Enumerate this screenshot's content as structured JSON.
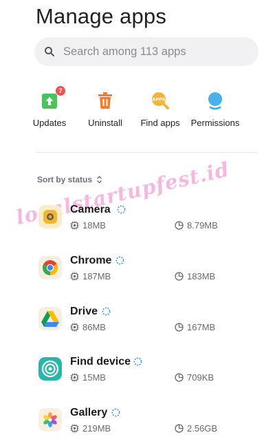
{
  "header": {
    "title": "Manage apps"
  },
  "search": {
    "placeholder": "Search among 113 apps",
    "icon": "search-icon"
  },
  "actions": [
    {
      "label": "Updates",
      "icon": "updates-icon",
      "badge": "7",
      "color": "#4cc25b"
    },
    {
      "label": "Uninstall",
      "icon": "trash-icon",
      "color": "#f57c2a"
    },
    {
      "label": "Find apps",
      "icon": "find-apps-icon",
      "icon_text": "APPS",
      "color": "#f2b53a"
    },
    {
      "label": "Permissions",
      "icon": "permissions-icon",
      "color": "#4ab0ec"
    }
  ],
  "sort": {
    "label": "Sort by status"
  },
  "watermark": "localstartupfest.id",
  "apps": [
    {
      "name": "Camera",
      "storage": "18MB",
      "data": "8.79MB",
      "icon": "camera-app-icon"
    },
    {
      "name": "Chrome",
      "storage": "187MB",
      "data": "183MB",
      "icon": "chrome-app-icon"
    },
    {
      "name": "Drive",
      "storage": "86MB",
      "data": "167MB",
      "icon": "drive-app-icon"
    },
    {
      "name": "Find device",
      "storage": "15MB",
      "data": "709KB",
      "icon": "find-device-app-icon"
    },
    {
      "name": "Gallery",
      "storage": "219MB",
      "data": "2.56GB",
      "icon": "gallery-app-icon"
    }
  ],
  "colors": {
    "accent": "#3b8ee0",
    "text": "#1a1a1a",
    "secondary": "#6a6a6e"
  }
}
